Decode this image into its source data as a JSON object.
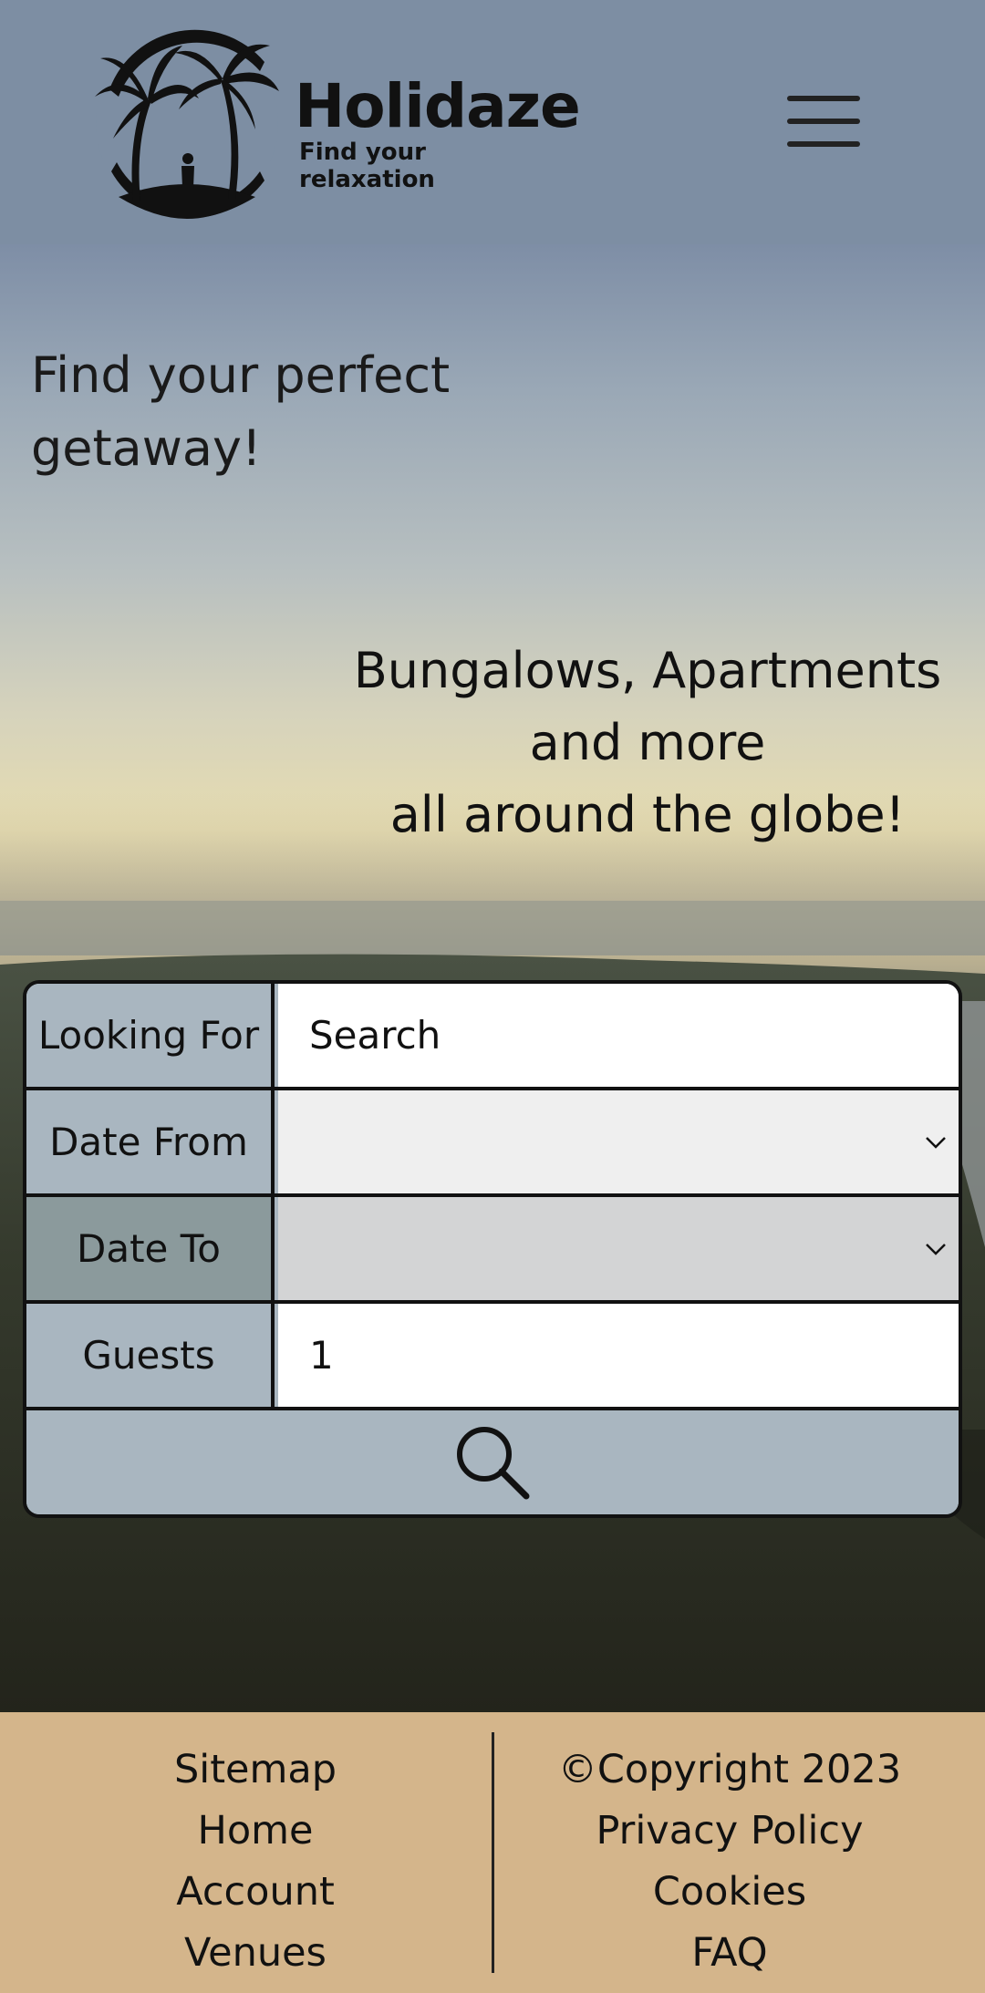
{
  "header": {
    "brand_name": "Holidaze",
    "brand_tagline": "Find your relaxation",
    "menu_icon": "hamburger-menu-icon",
    "background_color": "#7d8ea3"
  },
  "hero": {
    "title": "Find your perfect getaway!",
    "subtitle_line1": "Bungalows, Apartments",
    "subtitle_line2": "and more",
    "subtitle_line3": "all around the globe!"
  },
  "search_form": {
    "looking_for_label": "Looking For",
    "looking_for_placeholder": "Search",
    "looking_for_value": "",
    "date_from_label": "Date From",
    "date_from_value": "",
    "date_to_label": "Date To",
    "date_to_value": "",
    "guests_label": "Guests",
    "guests_value": "1",
    "submit_icon": "search-icon",
    "accent_color": "#a9b6c0"
  },
  "footer": {
    "left_links": [
      "Sitemap",
      "Home",
      "Account",
      "Venues"
    ],
    "copyright": "©Copyright 2023",
    "right_links": [
      "Privacy Policy",
      "Cookies",
      "FAQ"
    ],
    "background_color": "#d4b58b"
  }
}
